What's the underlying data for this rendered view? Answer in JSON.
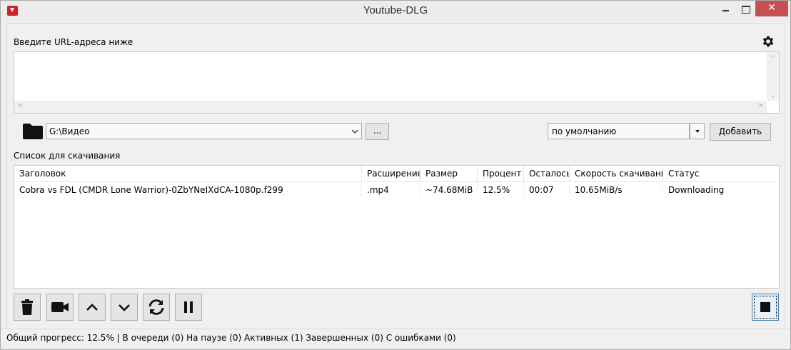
{
  "window": {
    "title": "Youtube-DLG",
    "close_glyph": "✕"
  },
  "url_section": {
    "label": "Введите URL-адреса ниже",
    "value": ""
  },
  "save_path": {
    "value": "G:\\Видео",
    "browse_label": "..."
  },
  "format": {
    "value": "по умолчанию"
  },
  "add_button": {
    "label": "Добавить"
  },
  "download_list": {
    "label": "Список для скачивания",
    "columns": [
      "Заголовок",
      "Расширение",
      "Размер",
      "Процент",
      "Осталось",
      "Скорость скачивания",
      "Статус"
    ],
    "rows": [
      [
        "Cobra vs FDL (CMDR Lone Warrior)-0ZbYNeIXdCA-1080p.f299",
        ".mp4",
        "~74.68MiB",
        "12.5%",
        "00:07",
        "10.65MiB/s",
        "Downloading"
      ]
    ]
  },
  "toolbar": {
    "icons": [
      "trash-icon",
      "video-camera-icon",
      "chevron-up-icon",
      "chevron-down-icon",
      "refresh-icon",
      "pause-icon",
      "stop-icon"
    ]
  },
  "status_bar": {
    "text": "Общий прогресс: 12.5% | В очереди (0) На паузе (0) Активных (1) Завершенных (0) С ошибками (0)"
  }
}
